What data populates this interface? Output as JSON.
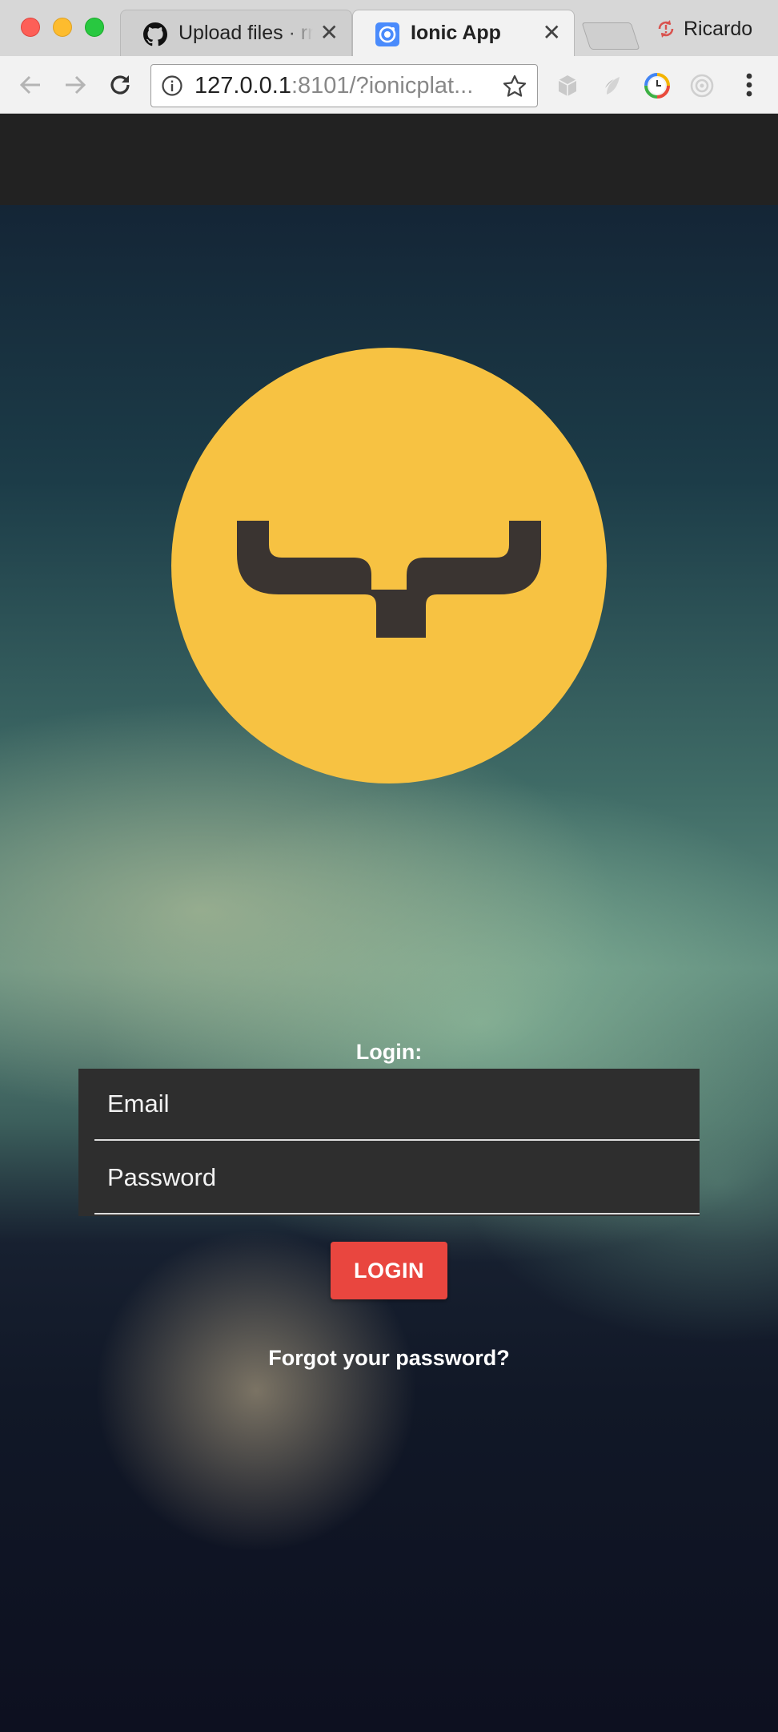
{
  "browser": {
    "tabs": [
      {
        "title": "Upload files · rr",
        "icon": "github-icon",
        "active": false
      },
      {
        "title": "Ionic App",
        "icon": "ionic-icon",
        "active": true
      }
    ],
    "close_glyph": "✕",
    "profile_name": "Ricardo",
    "url": {
      "host": "127.0.0.1",
      "rest": ":8101/?ionicplat..."
    }
  },
  "app": {
    "login_label": "Login:",
    "email_label": "Email",
    "password_label": "Password",
    "login_button": "LOGIN",
    "forgot_link": "Forgot your password?"
  },
  "colors": {
    "header": "#222222",
    "logo_circle": "#f7c242",
    "logo_mark": "#3a3431",
    "login_button": "#e9463f",
    "form_box": "#2e2e2e"
  }
}
